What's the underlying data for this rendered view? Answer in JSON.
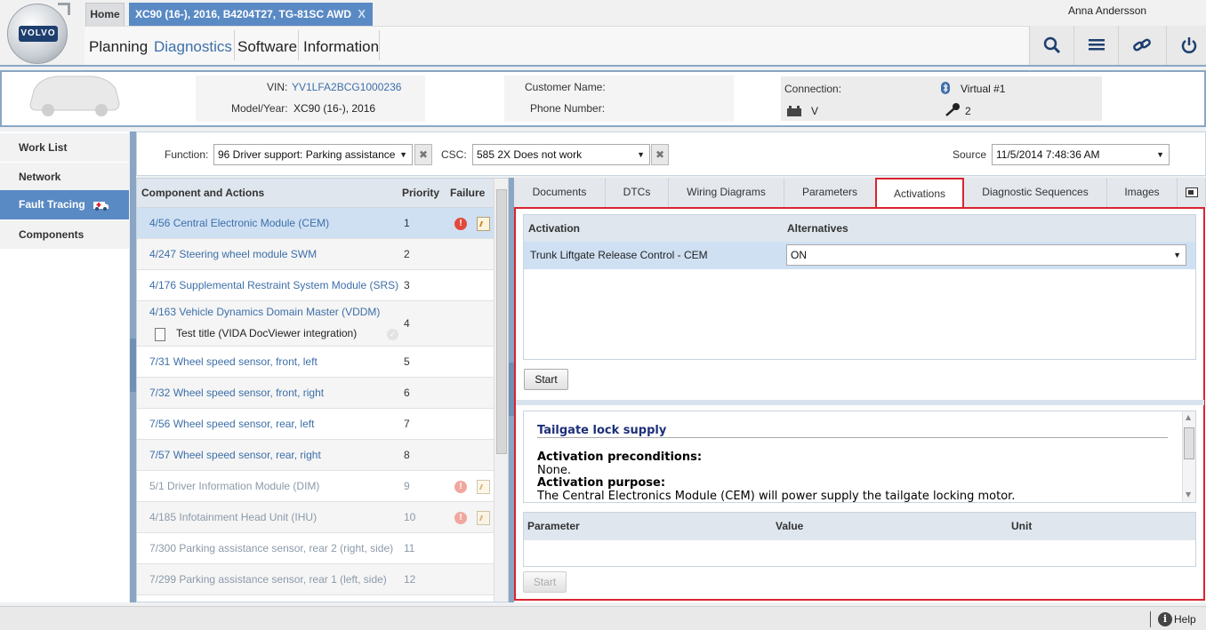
{
  "header": {
    "logo_text": "VOLVO",
    "tabs": [
      {
        "label": "Home"
      },
      {
        "label": "XC90 (16-), 2016, B4204T27, TG-81SC AWD",
        "close": "X"
      }
    ],
    "menu": [
      "Planning",
      "Diagnostics",
      "Software",
      "Information"
    ],
    "active_menu": "Diagnostics",
    "user": "Anna Andersson",
    "toolbar_icons": [
      "search-icon",
      "list-icon",
      "link-icon",
      "power-icon"
    ]
  },
  "vehicle": {
    "vin_label": "VIN:",
    "vin": "YV1LFA2BCG1000236",
    "model_label": "Model/Year:",
    "model": "XC90 (16-), 2016",
    "customer_label": "Customer Name:",
    "customer": "",
    "phone_label": "Phone Number:",
    "phone": "",
    "connection_label": "Connection:",
    "connection": "Virtual #1",
    "battery": "V",
    "key": "2"
  },
  "nav": {
    "items": [
      {
        "label": "Work List"
      },
      {
        "label": "Network"
      },
      {
        "label": "Fault Tracing"
      },
      {
        "label": "Components"
      }
    ],
    "active": "Fault Tracing"
  },
  "filters": {
    "function_label": "Function:",
    "function_value": "96 Driver support: Parking assistance",
    "csc_label": "CSC:",
    "csc_value": "585 2X Does not work",
    "source_label": "Source",
    "source_value": "11/5/2014 7:48:36 AM"
  },
  "components": {
    "headers": {
      "name": "Component and Actions",
      "priority": "Priority",
      "failure": "Failure"
    },
    "rows": [
      {
        "name": "4/56 Central Electronic Module (CEM)",
        "priority": "1",
        "failure": true,
        "note": true,
        "state": "selected"
      },
      {
        "name": "4/247 Steering wheel module SWM",
        "priority": "2",
        "failure": false,
        "note": false,
        "state": "normal"
      },
      {
        "name": "4/176 Supplemental Restraint System Module (SRS)",
        "priority": "3",
        "failure": false,
        "note": false,
        "state": "normal"
      },
      {
        "name": "4/163 Vehicle Dynamics Domain Master (VDDM)",
        "priority": "4",
        "failure": false,
        "note": false,
        "state": "normal",
        "sub": "Test title (VIDA DocViewer integration)"
      },
      {
        "name": "7/31 Wheel speed sensor, front, left",
        "priority": "5",
        "failure": false,
        "note": false,
        "state": "normal"
      },
      {
        "name": "7/32 Wheel speed sensor, front, right",
        "priority": "6",
        "failure": false,
        "note": false,
        "state": "normal"
      },
      {
        "name": "7/56 Wheel speed sensor, rear, left",
        "priority": "7",
        "failure": false,
        "note": false,
        "state": "normal"
      },
      {
        "name": "7/57 Wheel speed sensor, rear, right",
        "priority": "8",
        "failure": false,
        "note": false,
        "state": "normal"
      },
      {
        "name": "5/1 Driver Information Module (DIM)",
        "priority": "9",
        "failure": true,
        "note": true,
        "state": "dim"
      },
      {
        "name": "4/185 Infotainment Head Unit (IHU)",
        "priority": "10",
        "failure": true,
        "note": true,
        "state": "dim"
      },
      {
        "name": "7/300 Parking assistance sensor, rear 2 (right, side)",
        "priority": "11",
        "failure": false,
        "note": false,
        "state": "dim"
      },
      {
        "name": "7/299 Parking assistance sensor, rear 1 (left, side)",
        "priority": "12",
        "failure": false,
        "note": false,
        "state": "dim"
      }
    ]
  },
  "right_tabs": {
    "items": [
      "Documents",
      "DTCs",
      "Wiring Diagrams",
      "Parameters",
      "Activations",
      "Diagnostic Sequences",
      "Images"
    ],
    "active": "Activations"
  },
  "activation": {
    "col_activation": "Activation",
    "col_alternatives": "Alternatives",
    "row_name": "Trunk Liftgate Release Control - CEM",
    "row_value": "ON",
    "start_label": "Start"
  },
  "description": {
    "title": "Tailgate lock supply",
    "precond_label": "Activation preconditions:",
    "precond": "None.",
    "purpose_label": "Activation purpose:",
    "purpose": "The Central Electronics Module (CEM) will power supply the tailgate locking motor."
  },
  "params": {
    "col_parameter": "Parameter",
    "col_value": "Value",
    "col_unit": "Unit",
    "start_label": "Start"
  },
  "footer": {
    "help": "Help"
  },
  "colors": {
    "accent": "#5a8ac4",
    "highlight": "#d9242f",
    "link": "#3d6fa9"
  }
}
